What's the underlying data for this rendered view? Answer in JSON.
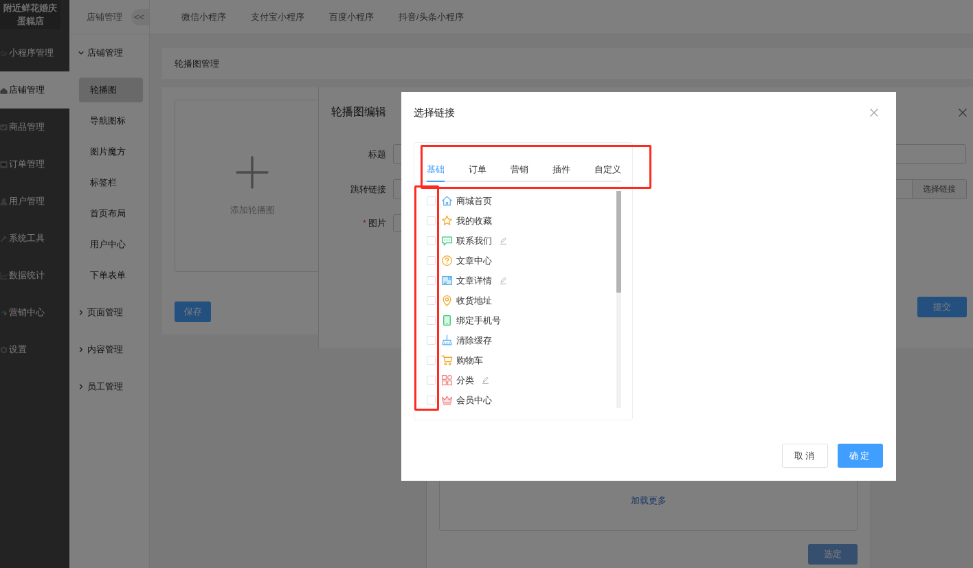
{
  "sidebar": {
    "logo": "附近鲜花婚庆蛋糕店",
    "items": [
      {
        "label": "小程序管理",
        "selected": false
      },
      {
        "label": "店铺管理",
        "selected": true
      },
      {
        "label": "商品管理",
        "selected": false
      },
      {
        "label": "订单管理",
        "selected": false
      },
      {
        "label": "用户管理",
        "selected": false
      },
      {
        "label": "系统工具",
        "selected": false
      },
      {
        "label": "数据统计",
        "selected": false
      },
      {
        "label": "营销中心",
        "selected": false
      },
      {
        "label": "设置",
        "selected": false
      }
    ]
  },
  "subnav": {
    "title": "店铺管理",
    "collapse": "<<",
    "groups": [
      {
        "label": "店铺管理",
        "expanded": true,
        "children": [
          {
            "label": "轮播图",
            "selected": true
          },
          {
            "label": "导航图标",
            "selected": false
          },
          {
            "label": "图片魔方",
            "selected": false
          },
          {
            "label": "标签栏",
            "selected": false
          },
          {
            "label": "首页布局",
            "selected": false
          },
          {
            "label": "用户中心",
            "selected": false
          },
          {
            "label": "下单表单",
            "selected": false
          }
        ]
      },
      {
        "label": "页面管理",
        "expanded": false
      },
      {
        "label": "内容管理",
        "expanded": false
      },
      {
        "label": "员工管理",
        "expanded": false
      }
    ]
  },
  "top_tabs": [
    "微信小程序",
    "支付宝小程序",
    "百度小程序",
    "抖音/头条小程序"
  ],
  "page": {
    "header": "轮播图管理",
    "upload_label": "添加轮播图",
    "save_button": "保存"
  },
  "edit_dialog": {
    "title": "轮播图编辑",
    "fields": [
      {
        "label": "标题"
      },
      {
        "label": "跳转链接",
        "button": "选择链接"
      },
      {
        "label": "图片",
        "marker": "*"
      }
    ],
    "submit": "提交"
  },
  "image_dialog": {
    "load_more": "加载更多",
    "confirm": "选定"
  },
  "link_dialog": {
    "title": "选择链接",
    "tabs": [
      {
        "label": "基础",
        "selected": true
      },
      {
        "label": "订单",
        "selected": false
      },
      {
        "label": "营销",
        "selected": false
      },
      {
        "label": "插件",
        "selected": false
      },
      {
        "label": "自定义",
        "selected": false
      }
    ],
    "items": [
      {
        "label": "商城首页",
        "checked": false,
        "editable": false
      },
      {
        "label": "我的收藏",
        "checked": false,
        "editable": false
      },
      {
        "label": "联系我们",
        "checked": false,
        "editable": true
      },
      {
        "label": "文章中心",
        "checked": false,
        "editable": false
      },
      {
        "label": "文章详情",
        "checked": false,
        "editable": true
      },
      {
        "label": "收货地址",
        "checked": false,
        "editable": false
      },
      {
        "label": "绑定手机号",
        "checked": false,
        "editable": false
      },
      {
        "label": "清除缓存",
        "checked": false,
        "editable": false
      },
      {
        "label": "购物车",
        "checked": false,
        "editable": false
      },
      {
        "label": "分类",
        "checked": false,
        "editable": true
      },
      {
        "label": "会员中心",
        "checked": false,
        "editable": false
      }
    ],
    "cancel": "取消",
    "ok": "确定",
    "tab_bar_highlighted": true,
    "checkbox_column_highlighted": true
  }
}
